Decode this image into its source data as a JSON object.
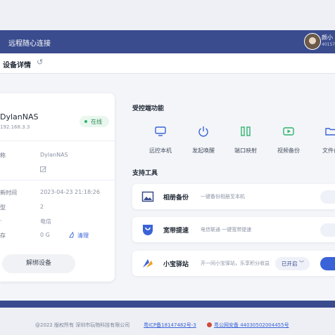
{
  "window": {
    "title": "远程随心连接"
  },
  "user": {
    "name": "颜小",
    "id": "40157"
  },
  "header": {
    "title": "设备详情",
    "back_icon": "undo-icon"
  },
  "device": {
    "name": "DylanNAS",
    "ip": "192.168.3.3",
    "status": "在线",
    "status_color": "#2fb46b",
    "fields": [
      {
        "key": "称",
        "value": "DylanNAS"
      },
      {
        "key": "",
        "value": ""
      },
      {
        "key": "新时间",
        "value": "2023-04-23 21:18:26"
      },
      {
        "key": "型",
        "value": "2"
      },
      {
        "key": "",
        "value": "电信"
      },
      {
        "key": "存",
        "value": "0 G"
      }
    ],
    "clean_label": "清理",
    "unbind_label": "解绑设备"
  },
  "controlled": {
    "title": "受控端功能",
    "items": [
      {
        "label": "远控本机",
        "icon": "monitor-icon"
      },
      {
        "label": "发起唤醒",
        "icon": "power-icon"
      },
      {
        "label": "端口映射",
        "icon": "port-map-icon"
      },
      {
        "label": "视频备份",
        "icon": "video-icon"
      },
      {
        "label": "文件备",
        "icon": "folder-icon"
      }
    ]
  },
  "tools": {
    "title": "支持工具",
    "items": [
      {
        "name": "相册备份",
        "desc": "一键备份相册至本机",
        "icon": "photo-icon",
        "state": ""
      },
      {
        "name": "宽带提速",
        "desc": "电信联通 一键宽带提速",
        "icon": "speed-icon",
        "state": ""
      },
      {
        "name": "小宝驿站",
        "desc": "开一间小宝驿站，乐享积分收益",
        "icon": "station-icon",
        "state": "已开启"
      }
    ]
  },
  "footer": {
    "copyright": "@2022 版权所有 深圳市玩物科技有限公司",
    "icp": "粤ICP备18147482号-3",
    "police": "粤公网安备 44030502004455号"
  },
  "colors": {
    "brand": "#3a4c8e",
    "accent": "#3a63d8"
  }
}
